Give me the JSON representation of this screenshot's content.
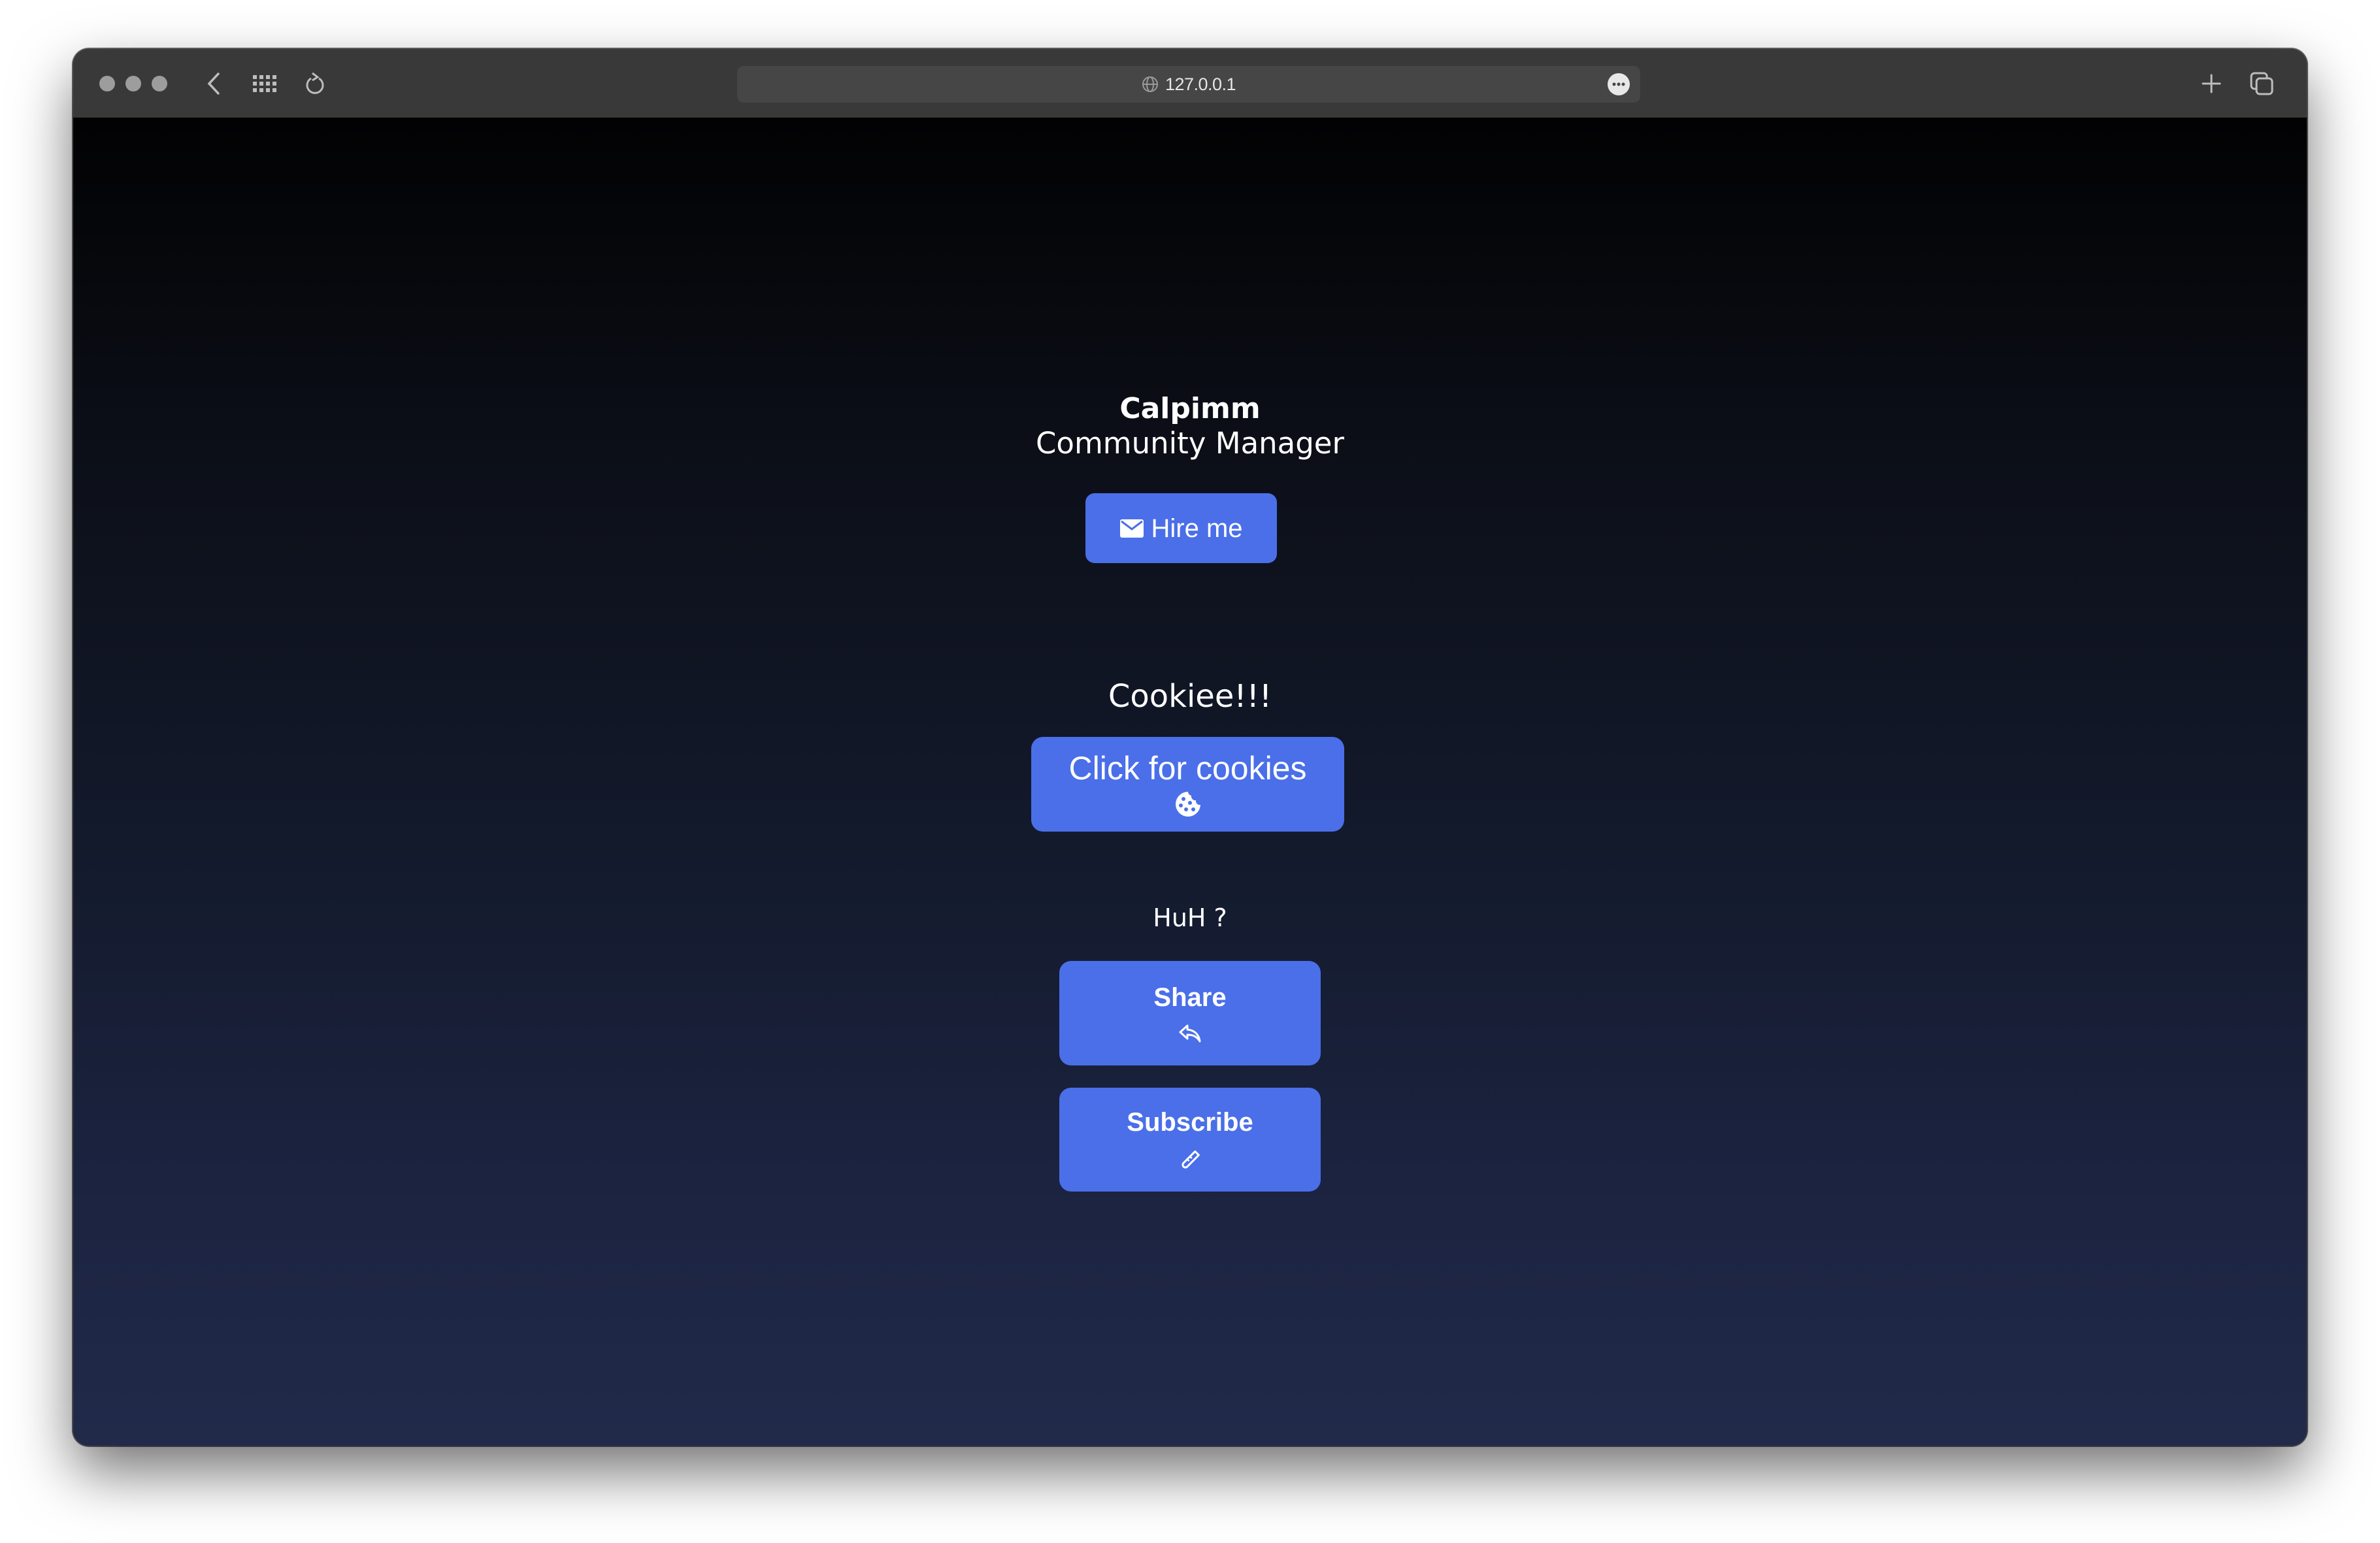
{
  "browser": {
    "url": "127.0.0.1",
    "icons": {
      "traffic_lights": "window-controls",
      "back": "chevron-left-icon",
      "tab_overview": "grid-icon",
      "reload": "reload-icon",
      "site": "globe-icon",
      "more": "ellipsis-icon",
      "new_tab": "plus-icon",
      "tabs": "tabs-icon"
    }
  },
  "profile": {
    "name": "Calpimm",
    "role": "Community Manager",
    "hire_button": {
      "label": "Hire me",
      "icon": "envelope-icon"
    }
  },
  "cookie_section": {
    "title": "Cookiee!!!",
    "button": {
      "label": "Click for cookies",
      "icon": "cookie-icon"
    }
  },
  "huh_section": {
    "title": "HuH ?",
    "share_button": {
      "label": "Share",
      "icon": "share-arrow-icon"
    },
    "subscribe_button": {
      "label": "Subscribe",
      "icon": "test-tube-icon"
    }
  },
  "colors": {
    "accent": "#4a6fe8",
    "toolbar": "#393939",
    "urlbar": "#464646",
    "gradient_top": "#020203",
    "gradient_bottom": "#222a4b"
  }
}
